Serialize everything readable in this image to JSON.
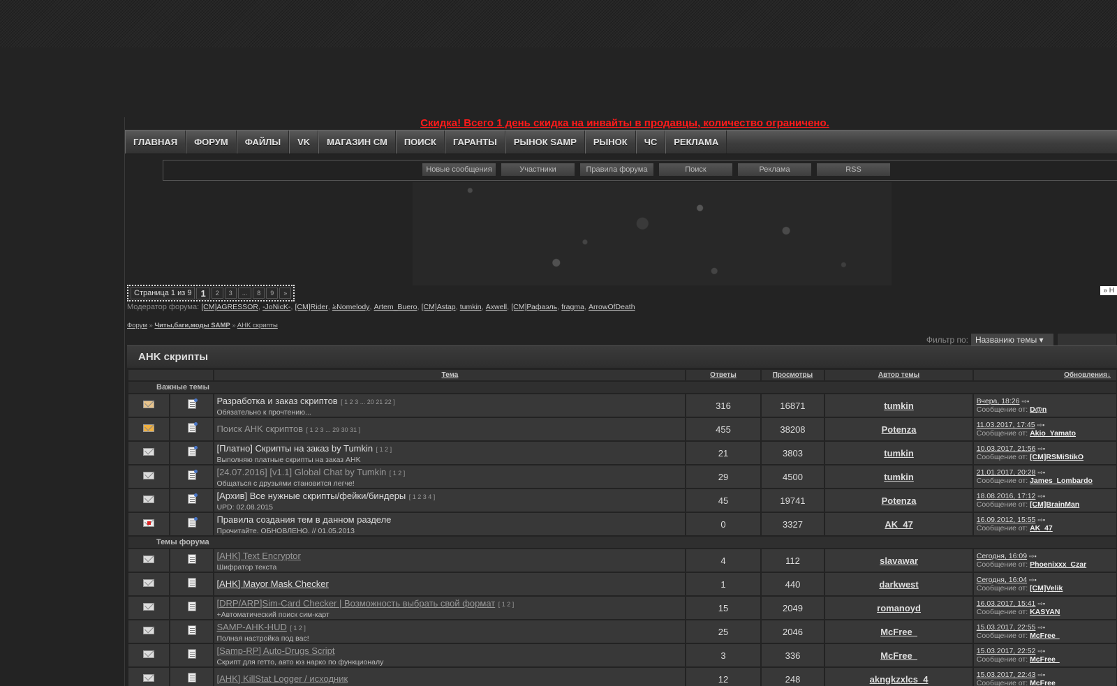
{
  "promo": "Скидка! Всего 1 день скидка на инвайты в продавцы, количество ограничено.",
  "nav": [
    "ГЛАВНАЯ",
    "ФОРУМ",
    "ФАЙЛЫ",
    "VK",
    "МАГАЗИН СМ",
    "ПОИСК",
    "ГАРАНТЫ",
    "РЫНОК SAMP",
    "РЫНОК",
    "ЧС",
    "РЕКЛАМА"
  ],
  "subnav": [
    "Новые сообщения",
    "Участники",
    "Правила форума",
    "Поиск",
    "Реклама",
    "RSS"
  ],
  "pager": {
    "label": "Страница 1 из 9",
    "current": "1",
    "pages": [
      "2",
      "3",
      "...",
      "8",
      "9",
      "»"
    ]
  },
  "right_link": "» Н",
  "moderators": {
    "label": "Модератор форума:",
    "names": [
      "[CM]AGRESSOR",
      "-JoNicK-",
      "[CM]Rider",
      "ঌNomelody",
      "Artem_Buero",
      "[CM]Astap",
      "tumkin",
      "Axwell",
      "[CM]Рафаэль",
      "fragma",
      "ArrowOfDeath"
    ]
  },
  "breadcrumbs": [
    "Форум",
    "Читы,баги,моды SAMP",
    "AHK скрипты"
  ],
  "filter": {
    "label": "Фильтр по:",
    "value": "Названию темы"
  },
  "section_title": "AHK скрипты",
  "columns": [
    "Тема",
    "Ответы",
    "Просмотры",
    "Автор темы",
    "Обновления↓"
  ],
  "groups": {
    "important": "Важные темы",
    "forum": "Темы форума"
  },
  "important_topics": [
    {
      "icon": "hot-envelope-icon",
      "title": "Разработка и заказ скриптов",
      "pages": "[ 1 2 3 ... 20 21 22 ]",
      "desc": "Обязательно к прочтению...",
      "replies": "316",
      "views": "16871",
      "author": "tumkin",
      "date": "Вчера, 18:26",
      "last_by": "D@n",
      "read": false
    },
    {
      "icon": "fire-envelope-icon",
      "title": "Поиск AHK скриптов",
      "pages": "[ 1 2 3 ... 29 30 31 ]",
      "desc": "",
      "replies": "455",
      "views": "38208",
      "author": "Potenza",
      "date": "11.03.2017, 17:45",
      "last_by": "Akio_Yamato",
      "read": true
    },
    {
      "icon": "envelope-icon",
      "title": "[Платно] Скрипты на заказ by Tumkin",
      "pages": "[ 1 2 ]",
      "desc": "Выполняю платные скрипты на заказ AHK",
      "replies": "21",
      "views": "3803",
      "author": "tumkin",
      "date": "10.03.2017, 21:56",
      "last_by": "[CM]RSMiStikO",
      "read": false
    },
    {
      "icon": "envelope-icon",
      "title": "[24.07.2016] [v1.1] Global Chat by Tumkin",
      "pages": "[ 1 2 ]",
      "desc": "Общаться с друзьями становится легче!",
      "replies": "29",
      "views": "4500",
      "author": "tumkin",
      "date": "21.01.2017, 20:28",
      "last_by": "James_Lombardo",
      "read": true
    },
    {
      "icon": "envelope-icon",
      "title": "[Архив] Все нужные скрипты/фейки/биндеры",
      "pages": "[ 1 2 3 4 ]",
      "desc": "UPD: 02.08.2015",
      "replies": "45",
      "views": "19741",
      "author": "Potenza",
      "date": "18.08.2016, 17:12",
      "last_by": "[CM]BrainMan",
      "read": false
    },
    {
      "icon": "locked-envelope-icon",
      "title": "Правила создания тем в данном разделе",
      "pages": "",
      "desc": "Прочитайте. ОБНОВЛЕНО. // 01.05.2013",
      "replies": "0",
      "views": "3327",
      "author": "AK_47",
      "date": "16.09.2012, 15:55",
      "last_by": "AK_47",
      "read": false
    }
  ],
  "forum_topics": [
    {
      "icon": "envelope-icon",
      "title": "[AHK] Text Encryptor",
      "pages": "",
      "desc": "Шифратор текста",
      "replies": "4",
      "views": "112",
      "author": "slavawar",
      "date": "Сегодня, 16:09",
      "last_by": "Phoenixxx_Czar",
      "read": true
    },
    {
      "icon": "envelope-icon",
      "title": "[AHK] Mayor Mask Checker",
      "pages": "",
      "desc": "",
      "replies": "1",
      "views": "440",
      "author": "darkwest",
      "date": "Сегодня, 16:04",
      "last_by": "[CM]Velik",
      "read": false
    },
    {
      "icon": "envelope-icon",
      "title": "[DRP/ARP]Sim-Card Checker | Возможность выбрать свой формат",
      "pages": "[ 1 2 ]",
      "desc": "+Автоматический поиск сим-карт",
      "replies": "15",
      "views": "2049",
      "author": "romanoyd",
      "date": "16.03.2017, 15:41",
      "last_by": "KASYAN",
      "read": true
    },
    {
      "icon": "envelope-icon",
      "title": "SAMP-AHK-HUD",
      "pages": "[ 1 2 ]",
      "desc": "Полная настройка под вас!",
      "replies": "25",
      "views": "2046",
      "author": "McFree_",
      "date": "15.03.2017, 22:55",
      "last_by": "McFree_",
      "read": true
    },
    {
      "icon": "envelope-icon",
      "title": "[Samp-RP] Auto-Drugs Script",
      "pages": "",
      "desc": "Скрипт для гетто, авто юз нарко по функционалу",
      "replies": "3",
      "views": "336",
      "author": "McFree_",
      "date": "15.03.2017, 22:52",
      "last_by": "McFree_",
      "read": true
    },
    {
      "icon": "envelope-icon",
      "title": "[AHK] KillStat Logger / исходник",
      "pages": "",
      "desc": "",
      "replies": "12",
      "views": "248",
      "author": "akngkzxlcs_4",
      "date": "15.03.2017, 22:43",
      "last_by": "McFree_",
      "read": true
    }
  ],
  "last_post_label": "Сообщение от:"
}
